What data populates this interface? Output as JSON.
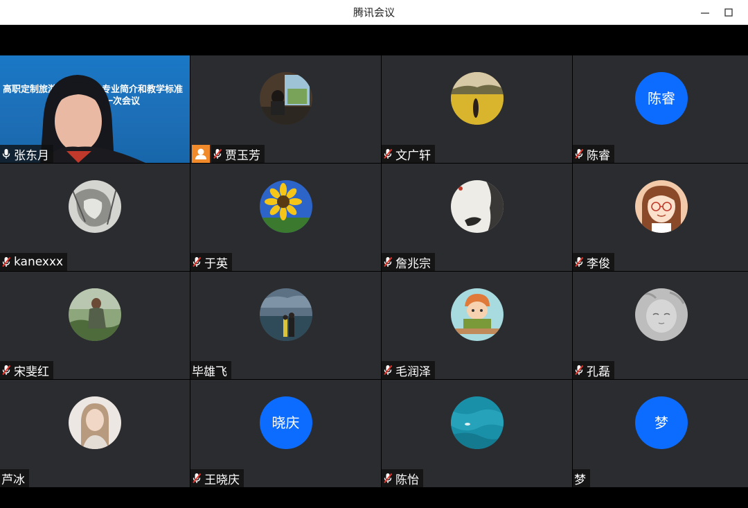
{
  "window": {
    "title": "腾讯会议"
  },
  "presenter": {
    "name": "张东月",
    "slide_line1": "高职定制旅游管理与服务专业简介和教学标准",
    "slide_line2": "一次会议"
  },
  "participants": [
    {
      "name": "贾玉芳",
      "muted": true,
      "host": true,
      "avatar": "photo-reading-by-window"
    },
    {
      "name": "文广轩",
      "muted": true,
      "avatar": "photo-yellow-flower-field"
    },
    {
      "name": "陈睿",
      "muted": true,
      "avatar_text": "陈睿"
    },
    {
      "name": "kanexxx",
      "muted": true,
      "avatar": "photo-sketch-art"
    },
    {
      "name": "于英",
      "muted": true,
      "avatar": "photo-sunflower"
    },
    {
      "name": "詹兆宗",
      "muted": true,
      "avatar": "photo-ink-painting"
    },
    {
      "name": "李俊",
      "muted": true,
      "avatar": "cartoon-girl-glasses"
    },
    {
      "name": "宋斐红",
      "muted": true,
      "avatar": "photo-person-outdoors"
    },
    {
      "name": "毕雄飞",
      "muted": false,
      "avatar": "photo-couple-seaside"
    },
    {
      "name": "毛润泽",
      "muted": true,
      "avatar": "cartoon-boy-reading"
    },
    {
      "name": "孔磊",
      "muted": true,
      "avatar": "photo-baby-sleeping"
    },
    {
      "name": "芦冰",
      "muted": false,
      "avatar": "photo-woman-portrait"
    },
    {
      "name": "王晓庆",
      "muted": true,
      "avatar_text": "晓庆"
    },
    {
      "name": "陈怡",
      "muted": true,
      "avatar": "photo-aerial-ocean"
    },
    {
      "name": "梦",
      "muted": false,
      "avatar_text": "梦"
    }
  ],
  "colors": {
    "avatar_blue": "#0b6cff",
    "host_badge": "#f08a2a",
    "active_border": "#2fb79a"
  }
}
